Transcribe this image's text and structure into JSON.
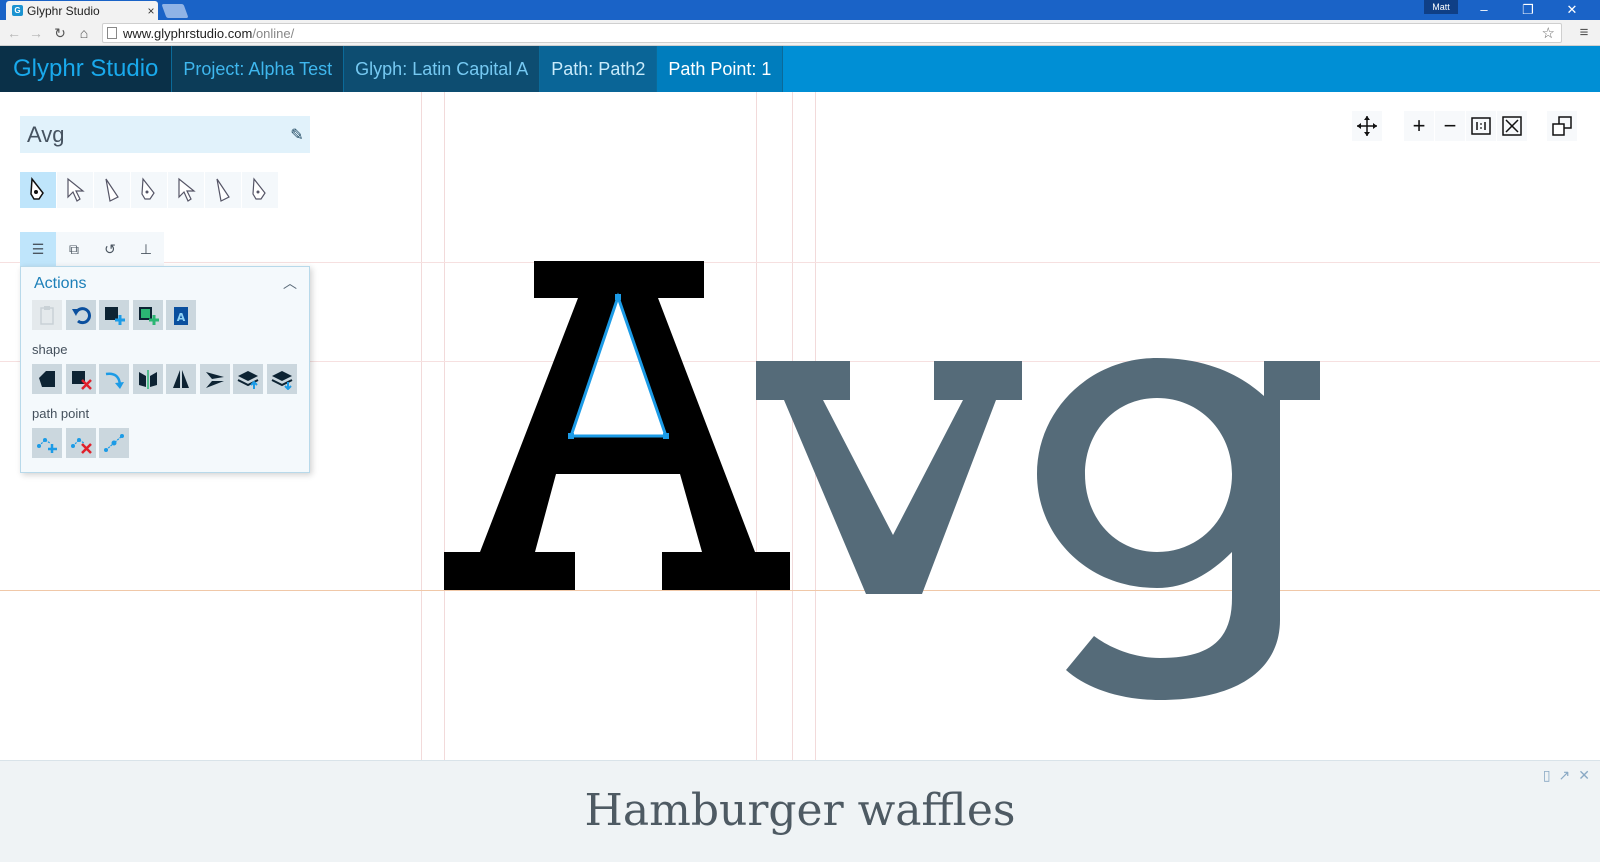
{
  "browser": {
    "tab_title": "Glyphr Studio",
    "tab_close": "×",
    "user_badge": "Matt",
    "minimize": "–",
    "restore": "❐",
    "close": "✕",
    "url_host": "www.glyphrstudio.com",
    "url_path": "/online/"
  },
  "appnav": {
    "logo": "Glyphr Studio",
    "project": "Project: Alpha Test",
    "glyph": "Glyph: Latin Capital A",
    "path": "Path: Path2",
    "path_point": "Path Point: 1"
  },
  "editor": {
    "glyph_name": "Avg",
    "active_tool_index": 0
  },
  "actions_panel": {
    "title": "Actions",
    "section_shape": "shape",
    "section_path_point": "path point"
  },
  "canvas": {
    "glyph_text": "Avg",
    "active_glyph": "A",
    "active_glyph_color": "#000000",
    "other_glyph_color": "#556b79",
    "selected_path_color": "#1c9be6"
  },
  "footer": {
    "ad_text": "Hamburger waffles"
  }
}
